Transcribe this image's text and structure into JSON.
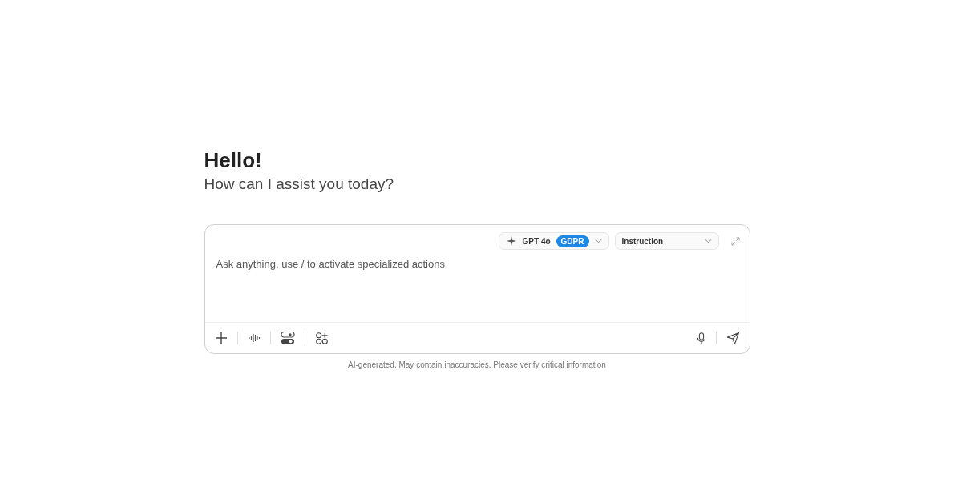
{
  "greeting": {
    "title": "Hello!",
    "subtitle": "How can I assist you today?"
  },
  "composer": {
    "model": {
      "name": "GPT 4o",
      "badge": "GDPR"
    },
    "mode": "Instruction",
    "placeholder": "Ask anything, use / to activate specialized actions"
  },
  "disclaimer": "AI-generated. May contain inaccuracies. Please verify critical information"
}
